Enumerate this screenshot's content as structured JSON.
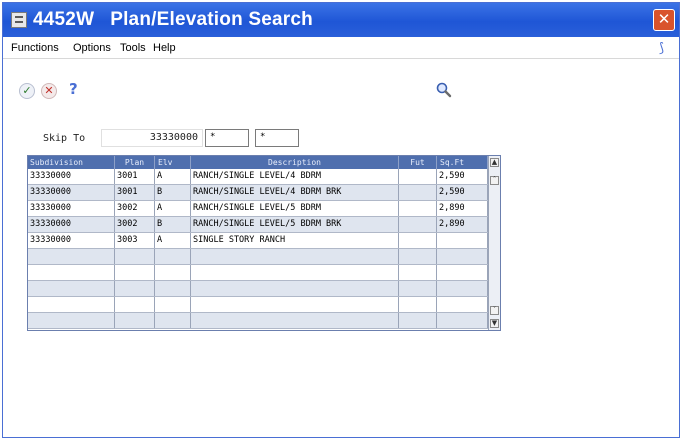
{
  "window": {
    "code": "4452W",
    "title": "Plan/Elevation Search"
  },
  "menu": [
    "Functions",
    "Options",
    "Tools",
    "Help"
  ],
  "toolbar": {
    "ok": "✓",
    "cancel": "✕",
    "help": "?",
    "close": "✕"
  },
  "skip": {
    "label": "Skip To",
    "value": "33330000",
    "field2": "*",
    "field3": "*"
  },
  "grid": {
    "columns": [
      "Subdivision",
      "Plan",
      "Elv",
      "Description",
      "Fut",
      "Sq.Ft"
    ],
    "rows": [
      [
        "33330000",
        "3001",
        "A",
        "RANCH/SINGLE LEVEL/4 BDRM",
        "",
        "2,590"
      ],
      [
        "33330000",
        "3001",
        "B",
        "RANCH/SINGLE LEVEL/4 BDRM BRK",
        "",
        "2,590"
      ],
      [
        "33330000",
        "3002",
        "A",
        "RANCH/SINGLE LEVEL/5 BDRM",
        "",
        "2,890"
      ],
      [
        "33330000",
        "3002",
        "B",
        "RANCH/SINGLE LEVEL/5 BDRM BRK",
        "",
        "2,890"
      ],
      [
        "33330000",
        "3003",
        "A",
        "SINGLE STORY RANCH",
        "",
        ""
      ],
      [
        "",
        "",
        "",
        "",
        "",
        ""
      ],
      [
        "",
        "",
        "",
        "",
        "",
        ""
      ],
      [
        "",
        "",
        "",
        "",
        "",
        ""
      ],
      [
        "",
        "",
        "",
        "",
        "",
        ""
      ],
      [
        "",
        "",
        "",
        "",
        "",
        ""
      ]
    ]
  },
  "icons": {
    "window": "app-window-icon",
    "close": "close-icon",
    "ok": "checkmark-icon",
    "cancel": "cancel-icon",
    "help": "help-icon",
    "find": "magnifier-icon",
    "menu_right": "exit-bar-icon"
  },
  "colors": {
    "titlebar": "#1f56d6",
    "grid_header": "#4f6fae",
    "row_alt": "#dfe5ef"
  }
}
